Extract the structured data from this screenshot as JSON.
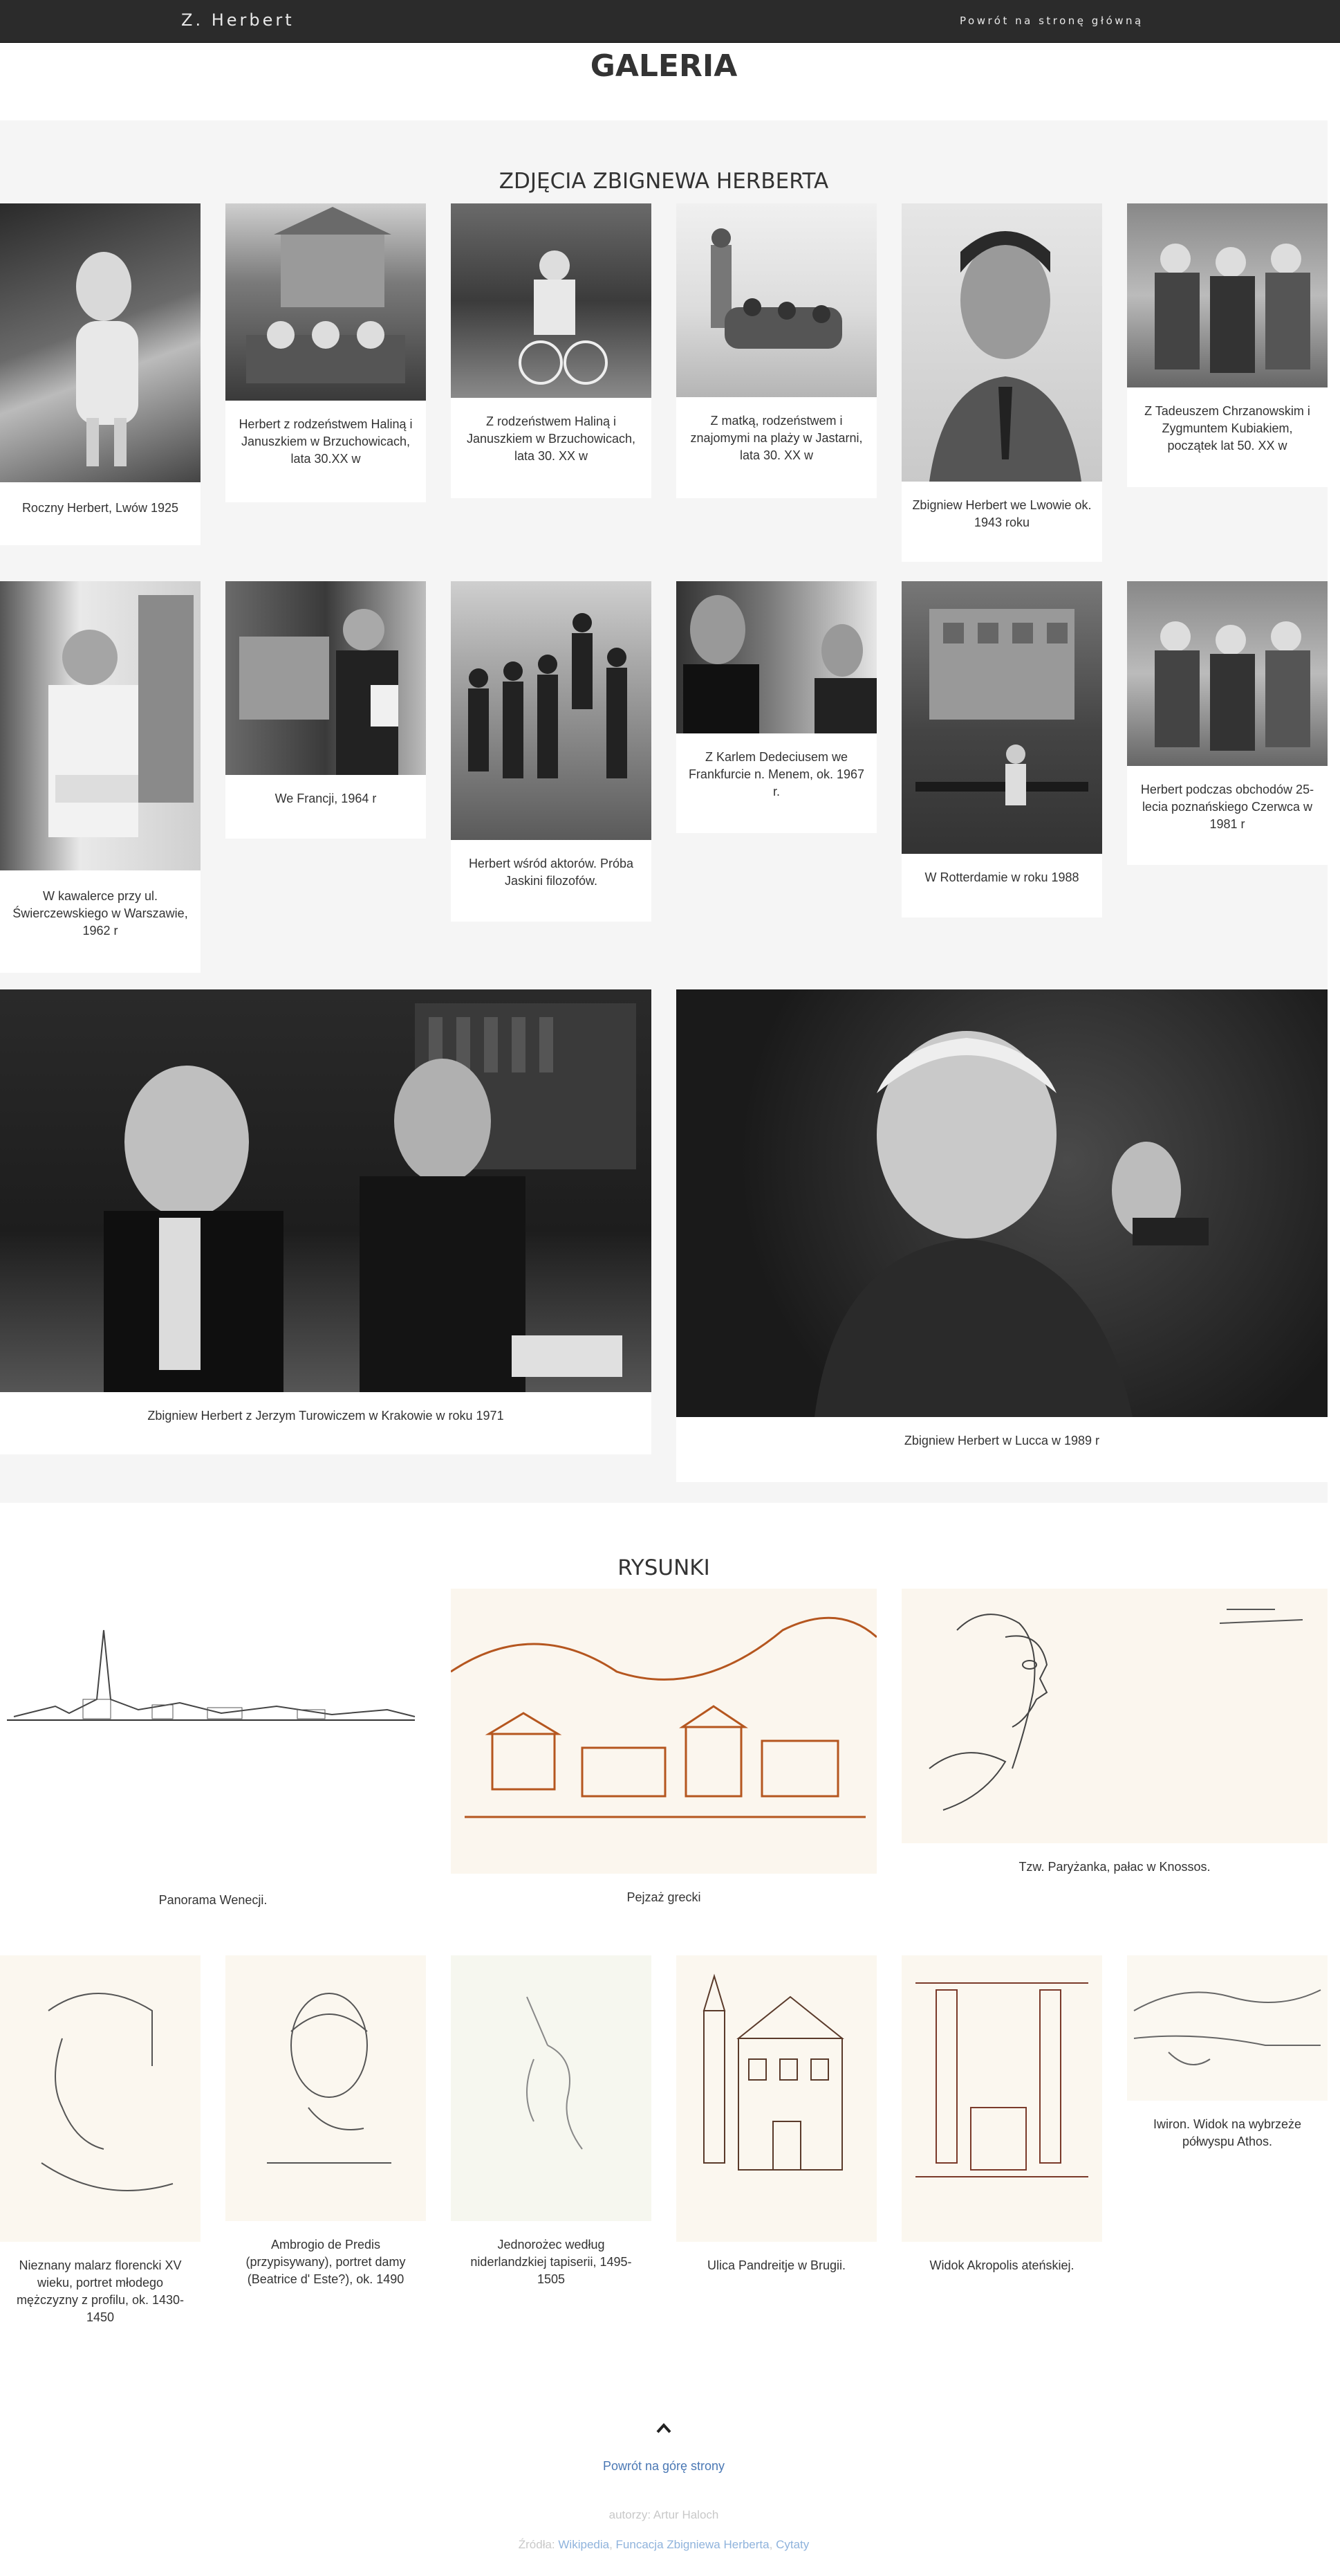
{
  "nav": {
    "brand": "Z. Herbert",
    "home_link": "Powrót na stronę główną"
  },
  "page": {
    "title": "GALERIA"
  },
  "photos_section": {
    "title": "ZDJĘCIA ZBIGNEWA HERBERTA",
    "items": [
      {
        "caption": "Roczny Herbert, Lwów 1925"
      },
      {
        "caption": "Herbert z rodzeństwem Haliną i Januszkiem w Brzuchowicach, lata 30.XX w"
      },
      {
        "caption": "Z rodzeństwem Haliną i Januszkiem w Brzuchowicach, lata 30. XX w"
      },
      {
        "caption": "Z matką, rodzeństwem i znajomymi na plaży w Jastarni, lata 30. XX w"
      },
      {
        "caption": "Zbigniew Herbert we Lwowie ok. 1943 roku"
      },
      {
        "caption": "Z Tadeuszem Chrzanowskim i Zygmuntem Kubiakiem, początek lat 50. XX w"
      },
      {
        "caption": "W kawalerce przy ul. Świerczewskiego w Warszawie, 1962 r"
      },
      {
        "caption": "We Francji, 1964 r"
      },
      {
        "caption": "Herbert wśród aktorów. Próba Jaskini filozofów."
      },
      {
        "caption": "Z Karlem Dedeciusem we Frankfurcie n. Menem, ok. 1967 r."
      },
      {
        "caption": "W Rotterdamie w roku 1988"
      },
      {
        "caption": "Herbert podczas obchodów 25-lecia poznańskiego Czerwca w 1981 r"
      },
      {
        "caption": "Zbigniew Herbert z Jerzym Turowiczem w Krakowie w roku 1971"
      },
      {
        "caption": "Zbigniew Herbert w Lucca w 1989 r"
      }
    ]
  },
  "drawings_section": {
    "title": "RYSUNKI",
    "items": [
      {
        "caption": "Panorama Wenecji."
      },
      {
        "caption": "Pejzaż grecki"
      },
      {
        "caption": "Tzw. Paryżanka, pałac w Knossos."
      },
      {
        "caption": "Nieznany malarz florencki XV wieku, portret młodego mężczyzny z profilu, ok. 1430-1450"
      },
      {
        "caption": "Ambrogio de Predis (przypisywany), portret damy (Beatrice d' Este?), ok. 1490"
      },
      {
        "caption": "Jednorożec według niderlandzkiej tapiserii, 1495-1505"
      },
      {
        "caption": "Ulica Pandreitje w Brugii."
      },
      {
        "caption": "Widok Akropolis ateńskiej."
      },
      {
        "caption": "Iwiron. Widok na wybrzeże półwyspu Athos."
      }
    ]
  },
  "footer": {
    "back_to_top": "Powrót na górę strony",
    "authors": "autorzy: Artur Haloch",
    "sources_label": "Źródła:",
    "sources": [
      "Wikipedia",
      "Funcacja Zbigniewa Herberta",
      "Cytaty"
    ]
  },
  "icons": {
    "back_to_top_icon": "chevron-up-icon"
  }
}
